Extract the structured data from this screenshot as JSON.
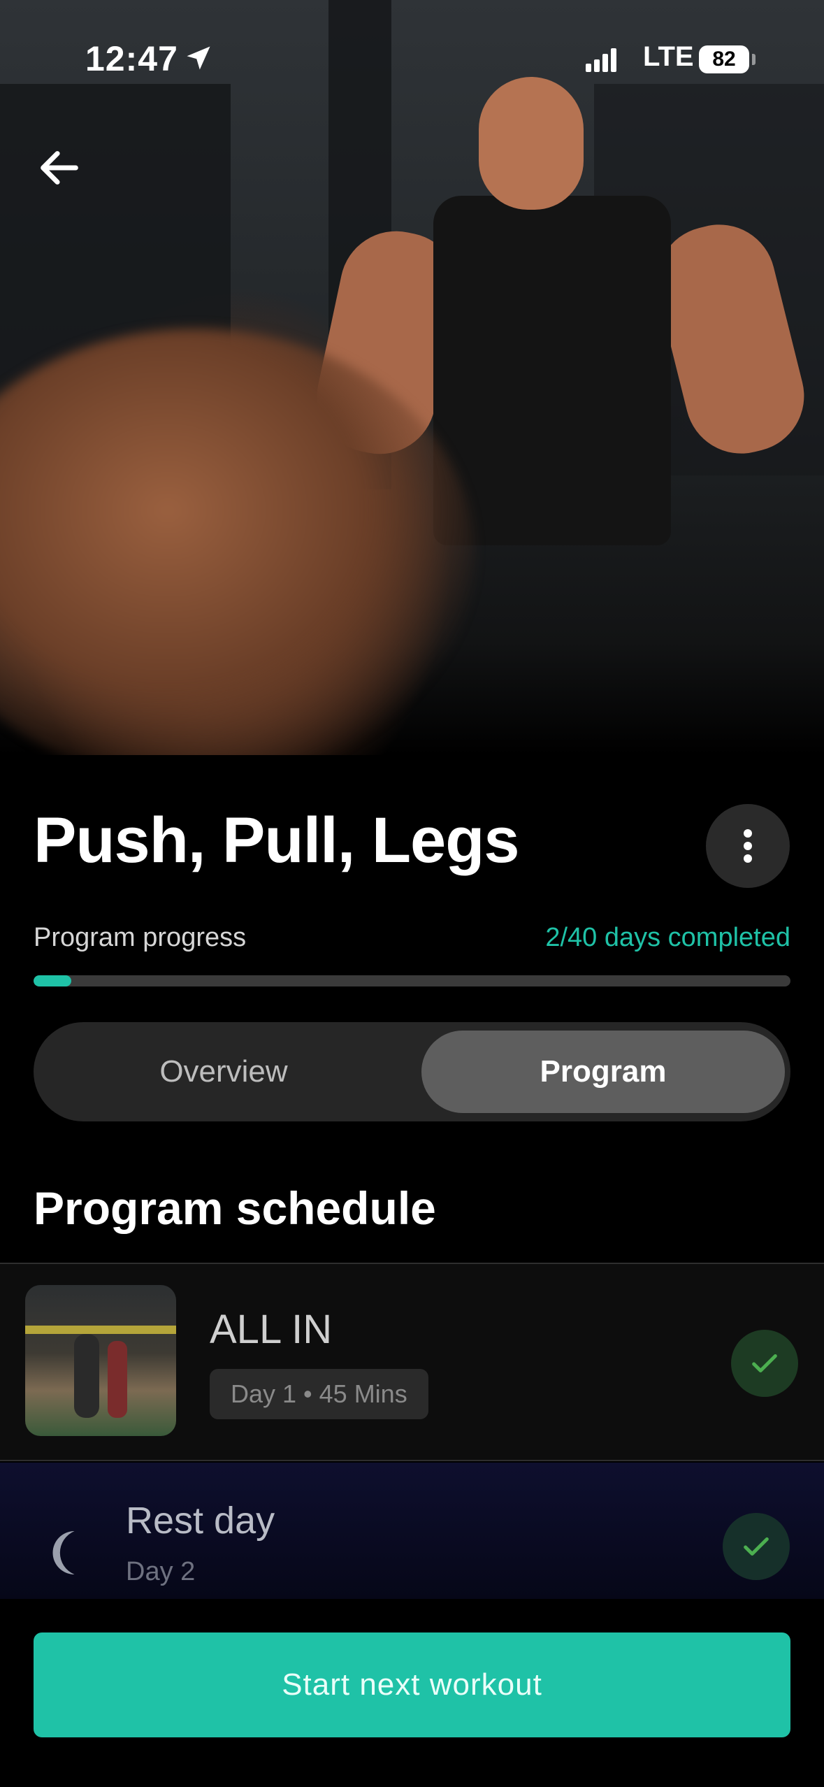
{
  "status_bar": {
    "time": "12:47",
    "network": "LTE",
    "battery": "82"
  },
  "program": {
    "title": "Push, Pull, Legs",
    "progress_label": "Program progress",
    "progress_text": "2/40 days completed",
    "progress_fraction": 0.05
  },
  "tabs": [
    {
      "label": "Overview",
      "selected": false
    },
    {
      "label": "Program",
      "selected": true
    }
  ],
  "schedule": {
    "title": "Program schedule",
    "items": [
      {
        "name": "ALL IN",
        "meta": "Day 1 • 45 Mins",
        "completed": true
      },
      {
        "name": "Rest day",
        "meta": "Day 2",
        "completed": true
      }
    ]
  },
  "cta": {
    "label": "Start next workout"
  },
  "colors": {
    "accent": "#1fc2a7",
    "background": "#000000",
    "check": "#4caf50"
  },
  "icons": [
    "back-arrow-icon",
    "location-arrow-icon",
    "more-vertical-icon",
    "check-icon",
    "moon-icon"
  ]
}
